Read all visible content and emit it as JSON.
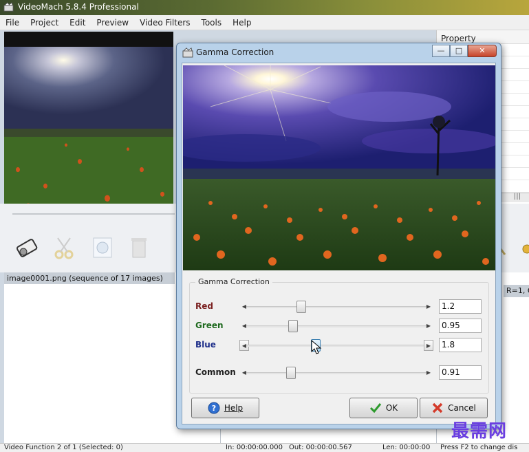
{
  "app": {
    "title": "VideoMach 5.8.4 Professional",
    "menu": [
      "File",
      "Project",
      "Edit",
      "Preview",
      "Video Filters",
      "Tools",
      "Help"
    ]
  },
  "property_panel": {
    "header": "Property"
  },
  "file_list": {
    "row": "image0001.png  (sequence of 17 images)"
  },
  "function_panel": {
    "value_text": "R=1, G"
  },
  "status_bar": {
    "functions": "Video Function 2 of 1  (Selected: 0)",
    "in": "In: 00:00:00.000",
    "out": "Out: 00:00:00.567",
    "len": "Len: 00:00:00",
    "hint": "Press F2 to change dis"
  },
  "dialog": {
    "title": "Gamma Correction",
    "group_label": "Gamma Correction",
    "sliders": [
      {
        "label": "Red",
        "value": "1.2",
        "position": 0.3,
        "color": "#7a1f1f"
      },
      {
        "label": "Green",
        "value": "0.95",
        "position": 0.25,
        "color": "#1f6a1f"
      },
      {
        "label": "Blue",
        "value": "1.8",
        "position": 0.38,
        "color": "#1e2f8a"
      },
      {
        "label": "Common",
        "value": "0.91",
        "position": 0.24,
        "color": "#222222"
      }
    ],
    "buttons": {
      "help": "Help",
      "ok": "OK",
      "cancel": "Cancel"
    }
  },
  "watermark": "最需网"
}
